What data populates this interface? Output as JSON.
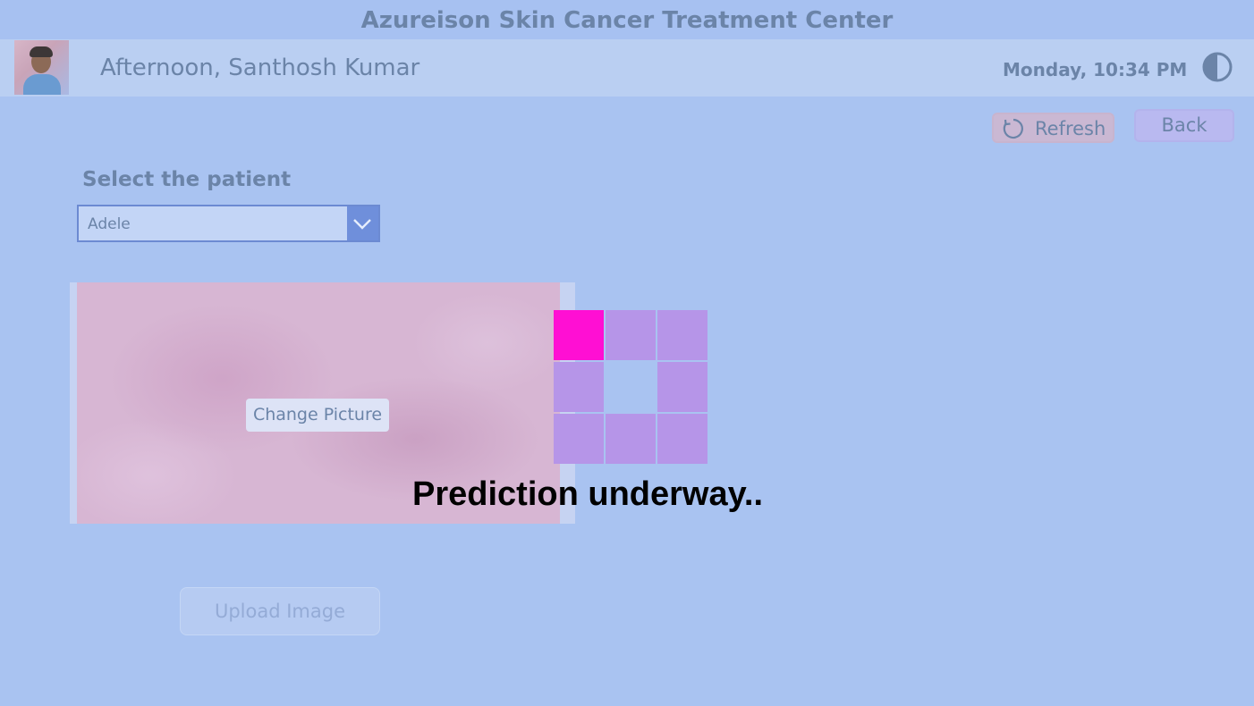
{
  "app": {
    "title": "Azureison Skin Cancer Treatment Center"
  },
  "header": {
    "greeting": "Afternoon, Santhosh Kumar",
    "datetime": "Monday, 10:34 PM"
  },
  "toolbar": {
    "refresh_label": "Refresh",
    "back_label": "Back"
  },
  "patient": {
    "select_label": "Select the patient",
    "selected": "Adele"
  },
  "image": {
    "change_label": "Change Picture"
  },
  "upload": {
    "label": "Upload Image"
  },
  "loading": {
    "text": "Prediction underway.."
  },
  "colors": {
    "background": "#a9c3f1",
    "header": "#bacff2",
    "dropdown_button": "#6f8fdb",
    "spinner_cell": "#b695e8",
    "spinner_active": "#ff0fd3"
  },
  "icons": {
    "theme": "half-circle-contrast-icon",
    "refresh": "refresh-icon",
    "dropdown": "chevron-down-icon"
  }
}
